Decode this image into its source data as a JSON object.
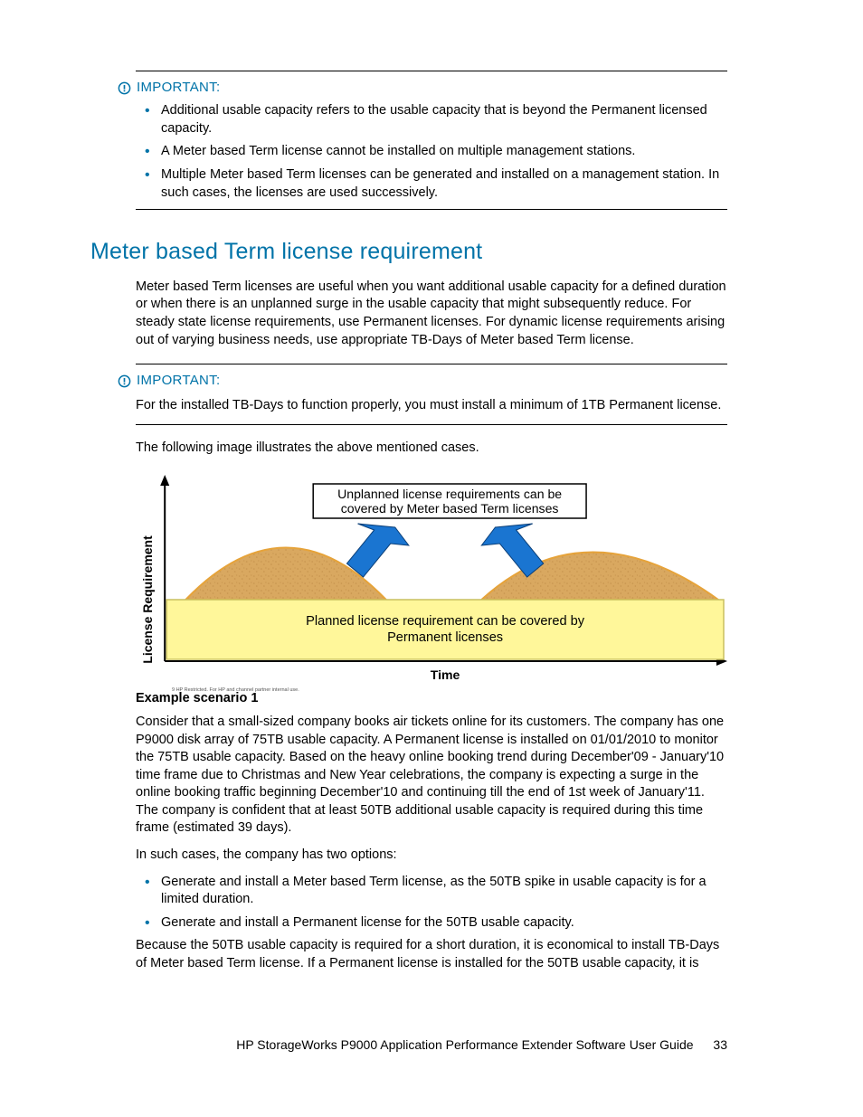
{
  "important1": {
    "label": "IMPORTANT:",
    "bullets": [
      "Additional usable capacity refers to the usable capacity that is beyond the Permanent licensed capacity.",
      "A Meter based Term license cannot be installed on multiple management stations.",
      "Multiple Meter based Term licenses can be generated and installed on a management station. In such cases, the licenses are used successively."
    ]
  },
  "section_title": "Meter based Term license requirement",
  "intro_para": "Meter based Term licenses are useful when you want additional usable capacity for a defined duration or when there is an unplanned surge in the usable capacity that might subsequently reduce. For steady state license requirements, use Permanent licenses. For dynamic license requirements arising out of varying business needs, use appropriate TB-Days of Meter based Term license.",
  "important2": {
    "label": "IMPORTANT:",
    "text": "For the installed TB-Days to function properly, you must install a minimum of 1TB Permanent license."
  },
  "fig_lead": "The following image illustrates the above mentioned cases.",
  "figure": {
    "yaxis": "License Requirement",
    "xaxis": "Time",
    "top_box_l1": "Unplanned license requirements can be",
    "top_box_l2": "covered by Meter based Term licenses",
    "mid_box_l1": "Planned license requirement can be covered by",
    "mid_box_l2": "Permanent licenses",
    "footnote": "9    HP Restricted. For HP and channel partner internal use."
  },
  "example": {
    "title": "Example scenario 1",
    "p1": "Consider that a small-sized company books air tickets online for its customers. The company has one P9000 disk array of 75TB usable capacity. A Permanent license is installed on 01/01/2010 to monitor the 75TB usable capacity. Based on the heavy online booking trend during December'09 - January'10 time frame due to Christmas and New Year celebrations, the company is expecting a surge in the online booking traffic beginning December'10 and continuing till the end of 1st week of January'11. The company is confident that at least 50TB additional usable capacity is required during this time frame (estimated 39 days).",
    "p2": "In such cases, the company has two options:",
    "bullets": [
      "Generate and install a Meter based Term license, as the 50TB spike in usable capacity is for a limited duration.",
      "Generate and install a Permanent license for the 50TB usable capacity."
    ],
    "p3": "Because the 50TB usable capacity is required for a short duration, it is economical to install TB-Days of Meter based Term license. If a Permanent license is installed for the 50TB usable capacity, it is"
  },
  "footer": {
    "title": "HP StorageWorks P9000 Application Performance Extender Software User Guide",
    "page": "33"
  }
}
